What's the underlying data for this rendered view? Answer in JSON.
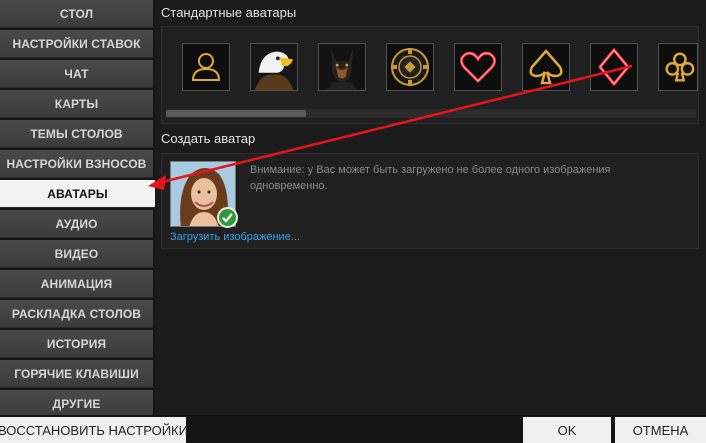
{
  "sidebar": {
    "items": [
      {
        "label": "СТОЛ"
      },
      {
        "label": "НАСТРОЙКИ СТАВОК"
      },
      {
        "label": "ЧАТ"
      },
      {
        "label": "КАРТЫ"
      },
      {
        "label": "ТЕМЫ СТОЛОВ"
      },
      {
        "label": "НАСТРОЙКИ ВЗНОСОВ"
      },
      {
        "label": "АВАТАРЫ",
        "active": true
      },
      {
        "label": "АУДИО"
      },
      {
        "label": "ВИДЕО"
      },
      {
        "label": "АНИМАЦИЯ"
      },
      {
        "label": "РАСКЛАДКА СТОЛОВ"
      },
      {
        "label": "ИСТОРИЯ"
      },
      {
        "label": "ГОРЯЧИЕ КЛАВИШИ"
      },
      {
        "label": "ДРУГИЕ"
      }
    ]
  },
  "standard_avatars": {
    "title": "Стандартные аватары",
    "icons": [
      "person-outline-icon",
      "eagle-avatar",
      "doberman-avatar",
      "poker-chip-avatar",
      "neon-heart-avatar",
      "neon-spade-avatar",
      "neon-diamond-avatar",
      "neon-club-avatar"
    ]
  },
  "create_avatar": {
    "title": "Создать аватар",
    "notice": "Внимание: у Вас может быть загружено не более одного изображения одновременно.",
    "upload_link": "Загрузить изображение..."
  },
  "footer": {
    "restore_label": "ВОССТАНОВИТЬ НАСТРОЙКИ",
    "ok_label": "OK",
    "cancel_label": "ОТМЕНА"
  },
  "colors": {
    "accent_link": "#3aa1e6",
    "annotation_arrow": "#e8141b",
    "neon_red": "#ff2a3a",
    "neon_gold": "#e0a93a"
  }
}
